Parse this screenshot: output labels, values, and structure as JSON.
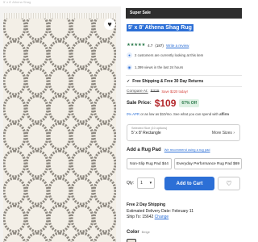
{
  "gallery": {
    "breadcrumb": "5' x 8' Athena Shag",
    "favorite_icon": "heart-icon"
  },
  "product": {
    "sale_banner": "Super Sale",
    "title": "5' x 8' Athena Shag Rug",
    "rating": {
      "stars": 4.7,
      "stars_text": "★★★★★",
      "score": "4.7",
      "count": "(187)",
      "write_review": "Write a review"
    },
    "social_proof": [
      {
        "icon": "people-icon",
        "text": "2 customers are currently looking at this item"
      },
      {
        "icon": "eye-icon",
        "text": "1,399 views in the last 24 hours"
      }
    ],
    "shipping_note": "Free Shipping & Free 30 Day Returns",
    "compare_at": {
      "label": "Compare At:",
      "price": "$329",
      "save": "Save $220 today!"
    },
    "sale_price": {
      "label": "Sale Price:",
      "price": "$109",
      "discount": "67% Off"
    },
    "financing": {
      "prefix": "0% APR",
      "text": " or as low as $10/mo. See what you can spend with ",
      "brand": "affirm"
    },
    "size": {
      "selected_label": "Selected Size (10 options)",
      "value": "5' x 8' Rectangle",
      "more": "More Sizes"
    },
    "rug_pad": {
      "heading": "Add a Rug Pad",
      "recommend_link": "We recommend using a rug pad",
      "options": [
        "Non-Slip Rug Pad $44",
        "Everyday Performance Rug Pad $69"
      ]
    },
    "quantity": {
      "label": "Qty:",
      "value": "1"
    },
    "add_to_cart": "Add to Cart",
    "delivery": {
      "title": "Free 2 Day Shipping",
      "estimate": "Estimated Delivery Date: February 11",
      "ship_to": "Ship To: 15642",
      "change": "Change"
    },
    "color": {
      "label": "Color",
      "value": "Beige"
    }
  },
  "colors": {
    "accent": "#2c6fd6",
    "sale_red": "#b3262a",
    "banner": "#2e2e2e",
    "rating_green": "#2b7a4b"
  }
}
